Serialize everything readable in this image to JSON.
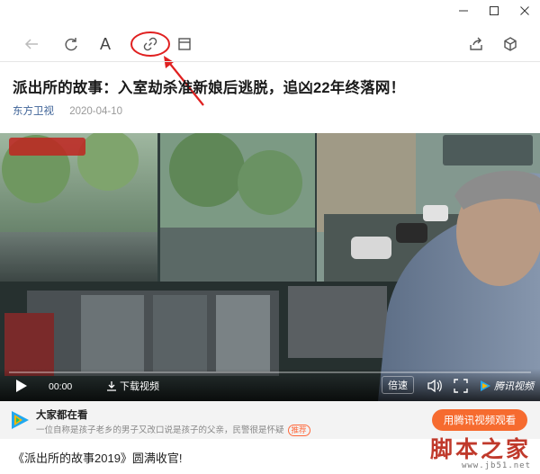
{
  "window": {
    "minimize_icon": "minimize-icon",
    "maximize_icon": "maximize-icon",
    "close_icon": "close-icon"
  },
  "toolbar": {
    "font_label": "A",
    "icons": [
      "back-arrow-icon",
      "refresh-icon",
      "font-size-icon",
      "link-icon",
      "window-icon",
      "share-icon",
      "cube-icon"
    ]
  },
  "article": {
    "title": "派出所的故事：入室劫杀准新娘后逃脱，追凶22年终落网！",
    "source": "东方卫视",
    "date": "2020-04-10",
    "first_paragraph": "《派出所的故事2019》圆满收官!"
  },
  "video": {
    "time": "00:00",
    "download_label": "下载视频",
    "speed_label": "倍速",
    "brand_label": "腾讯视频",
    "progress": 0
  },
  "recommendation": {
    "title": "大家都在看",
    "description": "一位自称是孩子老乡的男子又改口说是孩子的父亲，民警很是怀疑",
    "badge": "推荐",
    "button_label": "用腾讯视频观看"
  },
  "watermark": {
    "main": "脚本之家",
    "url": "www.jb51.net"
  },
  "colors": {
    "accent_orange": "#f66b2f",
    "source_blue": "#406599",
    "annotation_red": "#e02020"
  }
}
